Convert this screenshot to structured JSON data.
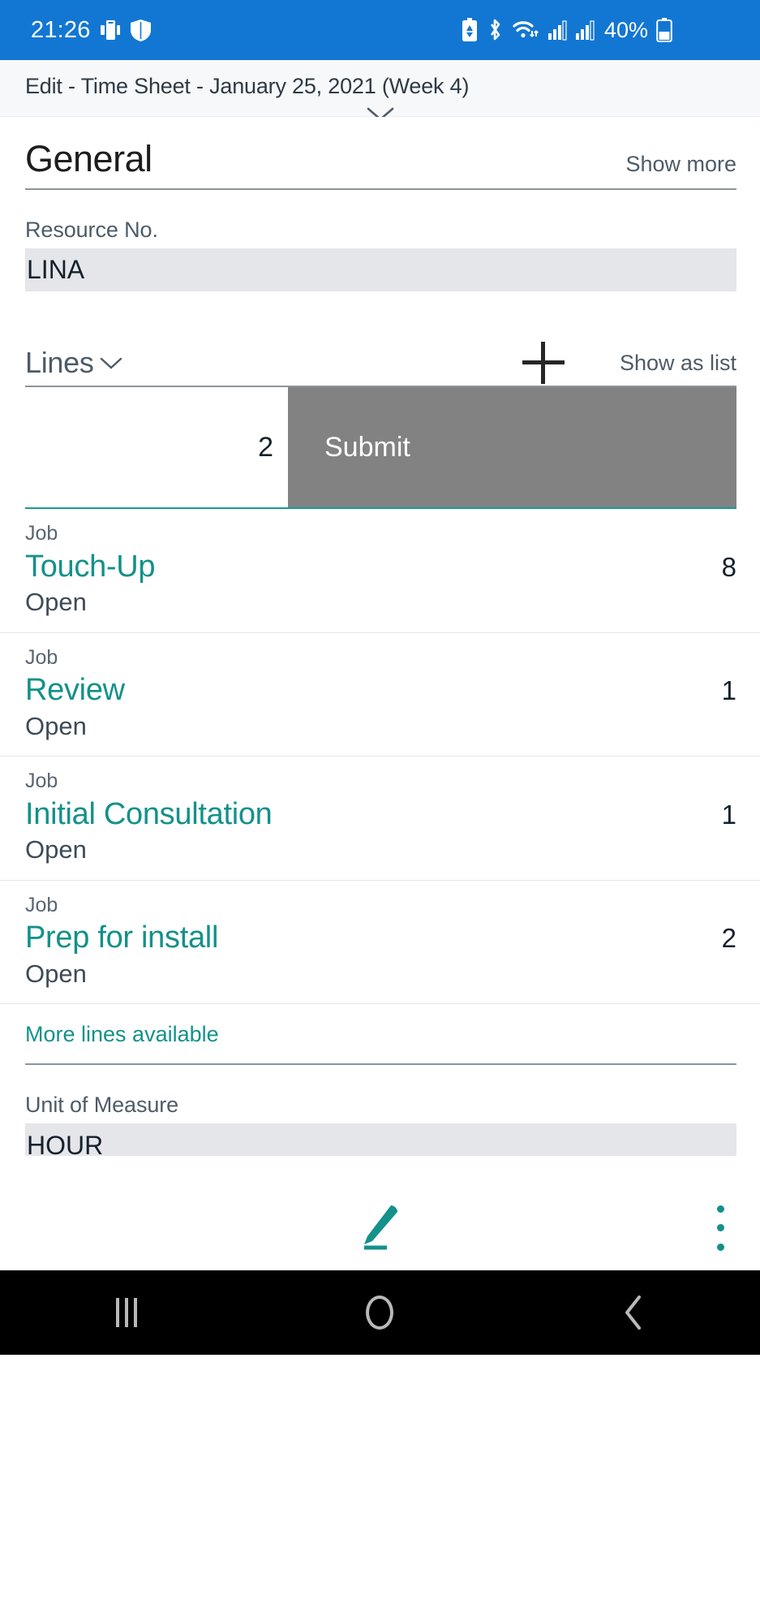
{
  "status_bar": {
    "time": "21:26",
    "battery_percent": "40%",
    "icons": [
      "screen-cast-icon",
      "shield-icon",
      "battery-saver-icon",
      "bluetooth-icon",
      "wifi-icon",
      "signal-sim1-icon",
      "signal-sim2-icon",
      "battery-icon"
    ],
    "background_color": "#1277d3"
  },
  "header": {
    "title": "Edit - Time Sheet - January 25, 2021 (Week 4)",
    "expand_icon": "chevron-down-icon"
  },
  "general": {
    "title": "General",
    "show_more_label": "Show more",
    "resource_no": {
      "label": "Resource No.",
      "value": "LINA"
    }
  },
  "lines": {
    "title": "Lines",
    "collapse_icon": "chevron-down-icon",
    "add_icon": "plus-icon",
    "show_as_list_label": "Show as list",
    "swipe_row": {
      "quantity": "2",
      "submit_label": "Submit"
    },
    "rows": [
      {
        "label": "Job",
        "name": "Touch-Up",
        "status": "Open",
        "quantity": "8"
      },
      {
        "label": "Job",
        "name": "Review",
        "status": "Open",
        "quantity": "1"
      },
      {
        "label": "Job",
        "name": "Initial Consultation",
        "status": "Open",
        "quantity": "1"
      },
      {
        "label": "Job",
        "name": "Prep for install",
        "status": "Open",
        "quantity": "2"
      }
    ],
    "more_lines_label": "More lines available"
  },
  "unit_of_measure": {
    "label": "Unit of Measure",
    "value": "HOUR"
  },
  "action_bar": {
    "edit_icon": "pencil-icon",
    "overflow_icon": "more-vertical-icon"
  },
  "nav_bar": {
    "recents": "recents-icon",
    "home": "home-icon",
    "back": "back-icon"
  },
  "colors": {
    "status_bar_blue": "#1277d3",
    "accent_teal": "#13918a",
    "submit_gray": "#828282",
    "input_gray": "#e5e6ea"
  }
}
